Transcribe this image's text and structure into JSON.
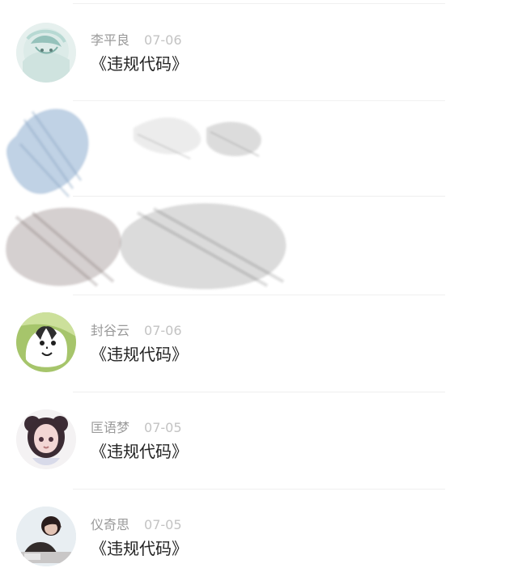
{
  "items": [
    {
      "author": "李平良",
      "date": "07-06",
      "title": "《违规代码》",
      "avatar_colors": [
        "#d9ece8",
        "#9ec6c0",
        "#f2f7f7"
      ]
    },
    {
      "author": "封谷云",
      "date": "07-06",
      "title": "《违规代码》",
      "avatar_colors": [
        "#6fa04b",
        "#d4e09e",
        "#2d2d2d"
      ]
    },
    {
      "author": "匡语梦",
      "date": "07-05",
      "title": "《违规代码》",
      "avatar_colors": [
        "#f3f1f2",
        "#3d2d35",
        "#c79da0"
      ]
    },
    {
      "author": "仪奇思",
      "date": "07-05",
      "title": "《违规代码》",
      "avatar_colors": [
        "#d7e5ed",
        "#2b1f1d",
        "#c8c6c6"
      ]
    }
  ],
  "colors": {
    "author": "#9a9a9a",
    "date": "#c3c3c3",
    "title": "#222222",
    "divider": "#efefef",
    "sketch_blue": "#6f98c2",
    "sketch_gray": "#6a6a6a",
    "sketch_brown": "#6b5752"
  }
}
